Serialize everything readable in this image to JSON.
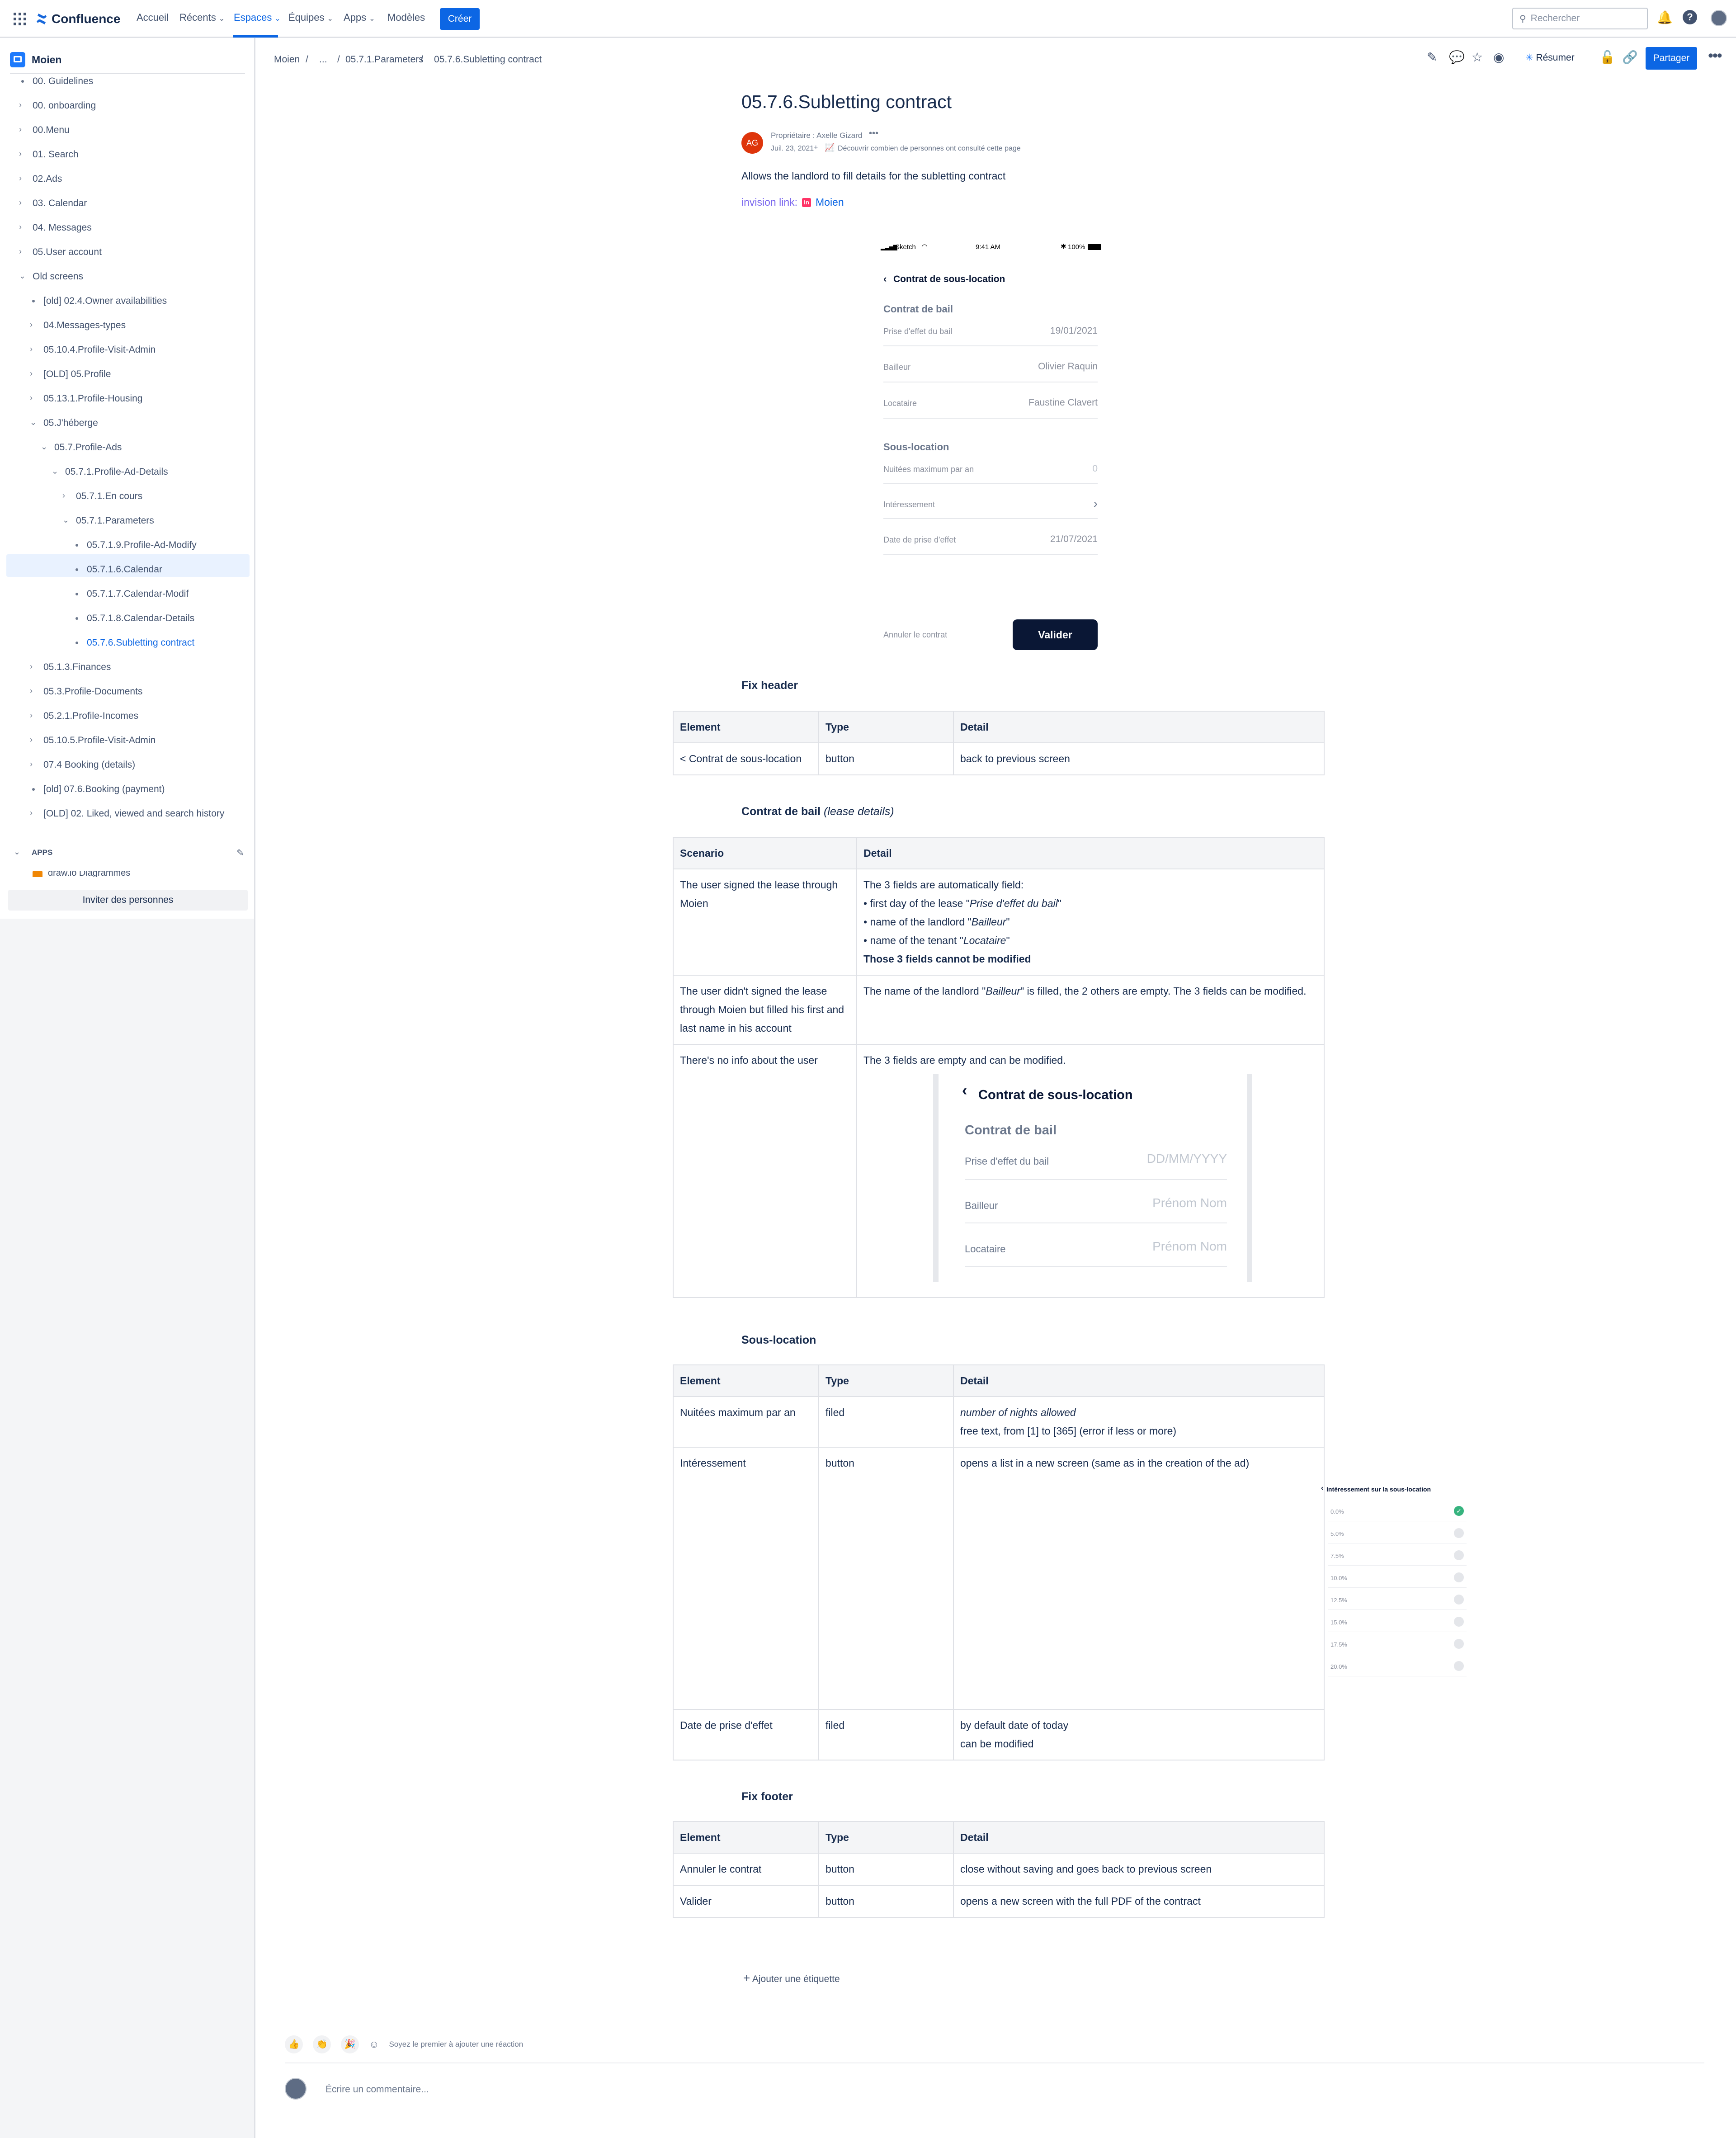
{
  "topnav": {
    "logo": "Confluence",
    "items": [
      "Accueil",
      "Récents",
      "Espaces",
      "Équipes",
      "Apps",
      "Modèles"
    ],
    "create": "Créer",
    "search_placeholder": "Rechercher"
  },
  "sidebar": {
    "space": "Moien",
    "tree": [
      {
        "label": "00. Guidelines",
        "type": "dot"
      },
      {
        "label": "00. onboarding",
        "type": "arrow"
      },
      {
        "label": "00.Menu",
        "type": "arrow"
      },
      {
        "label": "01. Search",
        "type": "arrow"
      },
      {
        "label": "02.Ads",
        "type": "arrow"
      },
      {
        "label": "03. Calendar",
        "type": "arrow"
      },
      {
        "label": "04. Messages",
        "type": "arrow"
      },
      {
        "label": "05.User account",
        "type": "arrow"
      },
      {
        "label": "Old screens",
        "type": "open"
      },
      {
        "label": "[old] 02.4.Owner availabilities",
        "type": "dot"
      },
      {
        "label": "04.Messages-types",
        "type": "arrow"
      },
      {
        "label": "05.10.4.Profile-Visit-Admin",
        "type": "arrow"
      },
      {
        "label": "[OLD] 05.Profile",
        "type": "arrow"
      },
      {
        "label": "05.13.1.Profile-Housing",
        "type": "arrow"
      },
      {
        "label": "05.J'héberge",
        "type": "open"
      },
      {
        "label": "05.7.Profile-Ads",
        "type": "open"
      },
      {
        "label": "05.7.1.Profile-Ad-Details",
        "type": "open"
      },
      {
        "label": "05.7.1.En cours",
        "type": "arrow"
      },
      {
        "label": "05.7.1.Parameters",
        "type": "open"
      },
      {
        "label": "05.7.1.9.Profile-Ad-Modify",
        "type": "dot"
      },
      {
        "label": "05.7.1.6.Calendar",
        "type": "dot"
      },
      {
        "label": "05.7.1.7.Calendar-Modif",
        "type": "dot"
      },
      {
        "label": "05.7.1.8.Calendar-Details",
        "type": "dot"
      },
      {
        "label": "05.7.6.Subletting contract",
        "type": "dot"
      },
      {
        "label": "05.1.3.Finances",
        "type": "arrow"
      },
      {
        "label": "05.3.Profile-Documents",
        "type": "arrow"
      },
      {
        "label": "05.2.1.Profile-Incomes",
        "type": "arrow"
      },
      {
        "label": "05.10.5.Profile-Visit-Admin",
        "type": "arrow"
      },
      {
        "label": "07.4 Booking (details)",
        "type": "arrow"
      },
      {
        "label": "[old] 07.6.Booking (payment)",
        "type": "dot"
      },
      {
        "label": "[OLD] 02. Liked, viewed and search history",
        "type": "arrow"
      }
    ],
    "apps_label": "APPS",
    "apps_item": "draw.io Diagrammes",
    "invite": "Inviter des personnes"
  },
  "breadcrumb": {
    "items": [
      "Moien",
      "...",
      "05.7.1.Parameters",
      "05.7.6.Subletting contract"
    ]
  },
  "actions": {
    "resume": "Résumer",
    "share": "Partager"
  },
  "page": {
    "title": "05.7.6.Subletting contract",
    "avatar_initials": "AG",
    "owner": "Propriétaire : Axelle Gizard",
    "date": "Juil. 23, 2021",
    "views": "Découvrir combien de personnes ont consulté cette page",
    "description": "Allows the landlord to fill details for the subletting contract",
    "invision_label": "invision link:",
    "invision_link": "Moien"
  },
  "phone": {
    "carrier": "Sketch",
    "time": "9:41 AM",
    "battery": "100%",
    "back_title": "Contrat de sous-location",
    "section1": "Contrat de bail",
    "rows1": [
      {
        "label": "Prise d'effet du bail",
        "value": "19/01/2021"
      },
      {
        "label": "Bailleur",
        "value": "Olivier Raquin"
      },
      {
        "label": "Locataire",
        "value": "Faustine Clavert"
      }
    ],
    "section2": "Sous-location",
    "rows2": [
      {
        "label": "Nuitées maximum par an",
        "value": "0"
      },
      {
        "label": "Intéressement",
        "value": "›"
      },
      {
        "label": "Date de prise d'effet",
        "value": "21/07/2021"
      }
    ],
    "cancel": "Annuler le contrat",
    "validate": "Valider"
  },
  "fix_header": {
    "title": "Fix header",
    "headers": [
      "Element",
      "Type",
      "Detail"
    ],
    "rows": [
      [
        "< Contrat de sous-location",
        "button",
        "back to previous screen"
      ]
    ]
  },
  "contrat_bail": {
    "title": "Contrat de bail",
    "title_note": "(lease details)",
    "headers": [
      "Scenario",
      "Detail"
    ],
    "s1": "The user signed the lease through Moien",
    "d1_intro": "The 3 fields are automatically field:",
    "d1_b1_pre": "• first day of the lease \"",
    "d1_b1_em": "Prise d'effet du bail",
    "d1_b2_pre": "• name of the landlord \"",
    "d1_b2_em": "Bailleur",
    "d1_b3_pre": "• name of the tenant \"",
    "d1_b3_em": "Locataire",
    "d1_bold": "Those 3 fields cannot be modified",
    "s2": "The user didn't signed the lease through Moien but filled his first and last name in his account",
    "d2_pre": "The name of the landlord \"",
    "d2_em": "Bailleur",
    "d2_post": "\" is filled, the 2 others are empty. The 3 fields can be modified.",
    "s3": "There's no info about the user",
    "d3": "The 3 fields are empty and can be modified.",
    "embed": {
      "title": "Contrat de sous-location",
      "section": "Contrat de bail",
      "rows": [
        {
          "label": "Prise d'effet du bail",
          "placeholder": "DD/MM/YYYY"
        },
        {
          "label": "Bailleur",
          "placeholder": "Prénom Nom"
        },
        {
          "label": "Locataire",
          "placeholder": "Prénom Nom"
        }
      ]
    }
  },
  "sous_location": {
    "title": "Sous-location",
    "headers": [
      "Element",
      "Type",
      "Detail"
    ],
    "r1": {
      "el": "Nuitées maximum par an",
      "type": "filed",
      "d_em": "number of nights allowed",
      "d": "free text, from [1] to [365] (error if less or more)"
    },
    "r2": {
      "el": "Intéressement",
      "type": "button",
      "d": "opens a list in a new screen (same as in the creation of the ad)"
    },
    "r3": {
      "el": "Date de prise d'effet",
      "type": "filed",
      "d1": "by default date of today",
      "d2": "can be modified"
    },
    "picker": {
      "title": "Intéressement sur la sous-location",
      "options": [
        "0.0%",
        "5.0%",
        "7.5%",
        "10.0%",
        "12.5%",
        "15.0%",
        "17.5%",
        "20.0%"
      ]
    }
  },
  "fix_footer": {
    "title": "Fix footer",
    "headers": [
      "Element",
      "Type",
      "Detail"
    ],
    "rows": [
      [
        "Annuler le contrat",
        "button",
        "close without saving and goes back to previous screen"
      ],
      [
        "Valider",
        "button",
        "opens a new screen with the full PDF of the contract"
      ]
    ]
  },
  "footer": {
    "add_label": "Ajouter une étiquette",
    "reaction_prompt": "Soyez le premier à ajouter une réaction",
    "comment_placeholder": "Écrire un commentaire..."
  },
  "colors": {
    "primary": "#0c66e4",
    "navy": "#0a1735",
    "accent_link": "#7b68ee"
  }
}
